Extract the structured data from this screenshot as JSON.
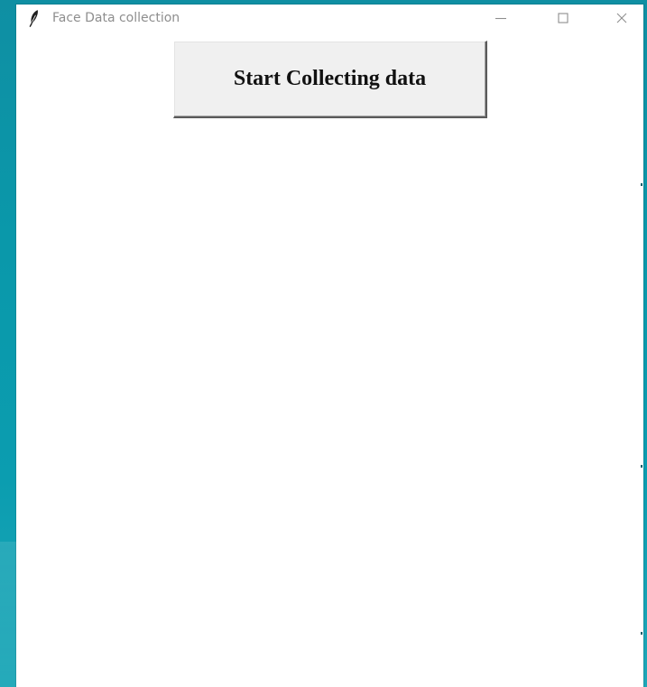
{
  "window": {
    "title": "Face Data collection",
    "icon": "feather-icon",
    "controls": [
      "minimize-icon",
      "maximize-icon",
      "close-icon"
    ]
  },
  "main": {
    "start_button_label": "Start Collecting data"
  },
  "colors": {
    "desktop_background": "#0f8fa3",
    "window_background": "#ffffff",
    "button_background": "#f0f0f0",
    "title_text": "#8e8e8e"
  }
}
